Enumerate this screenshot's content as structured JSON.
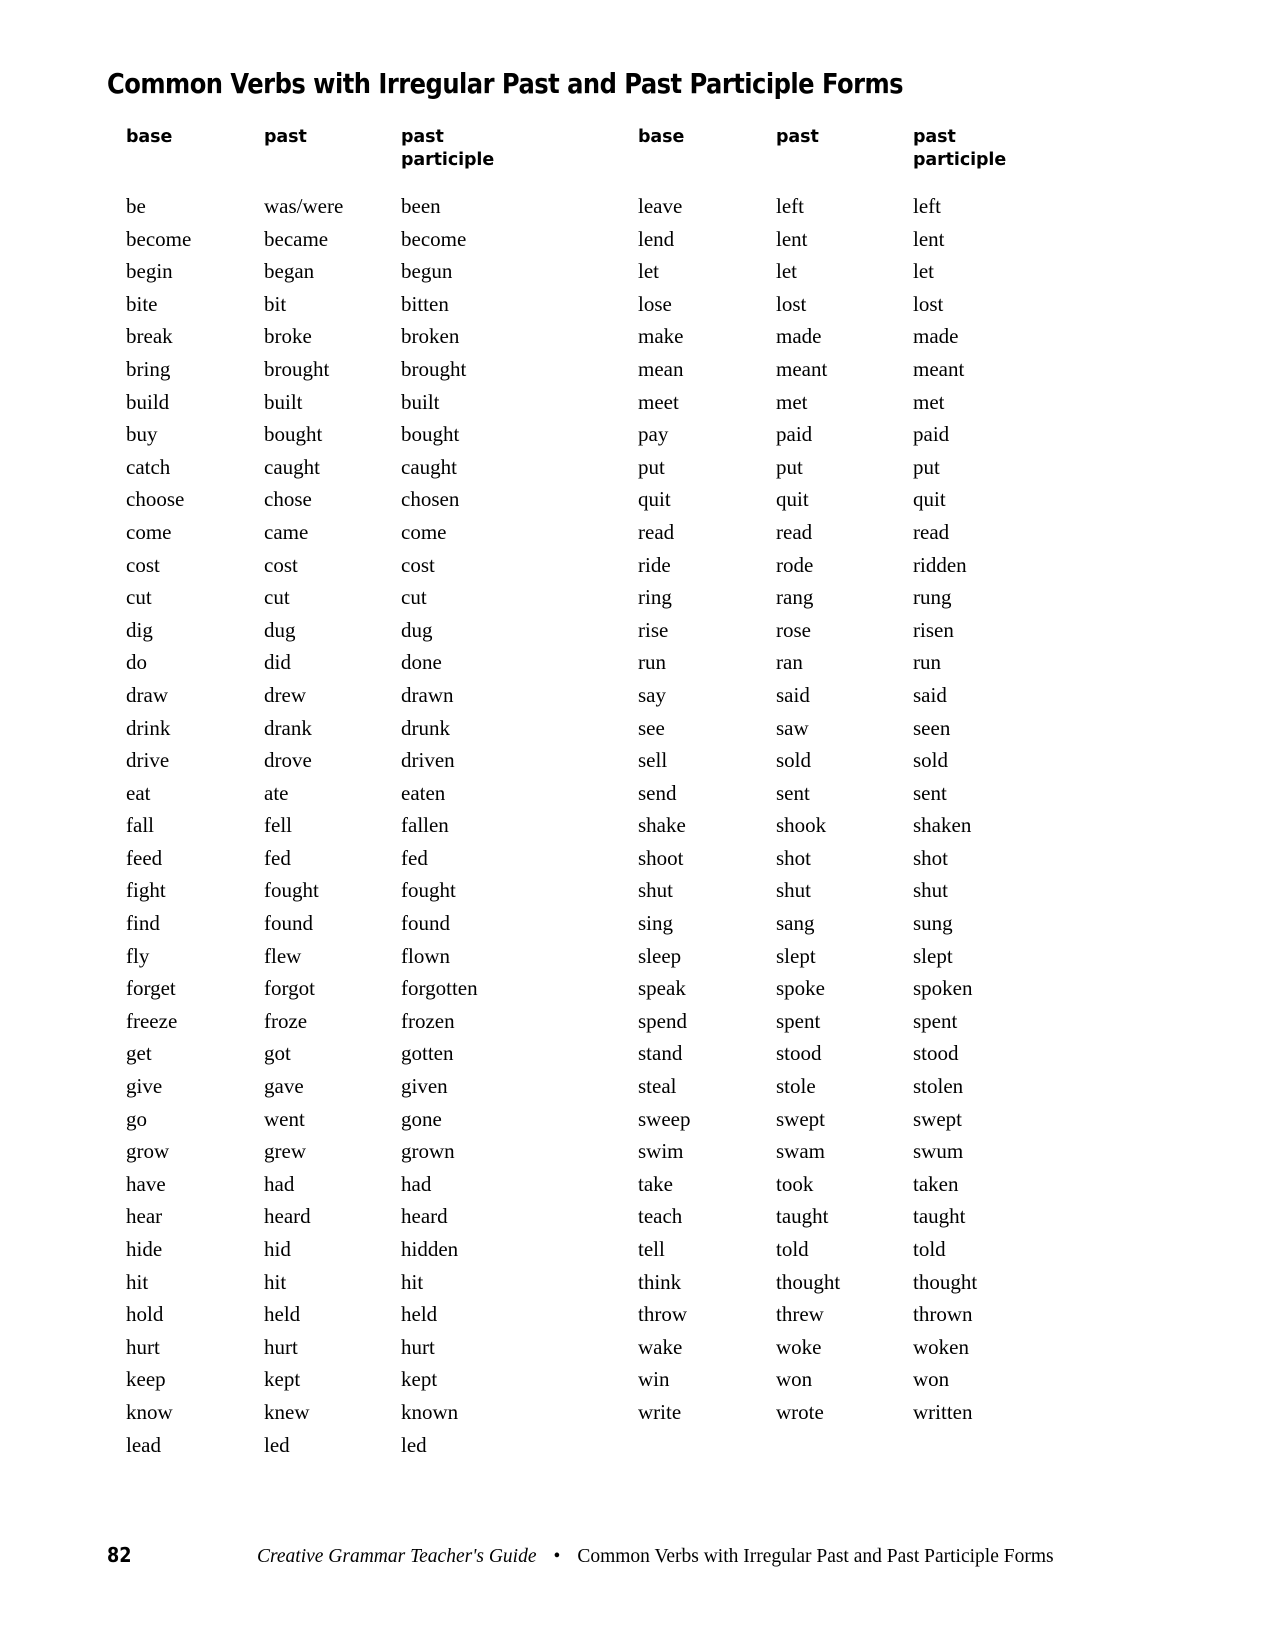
{
  "title": "Common Verbs with Irregular Past and Past Participle Forms",
  "columns": {
    "base": "base",
    "past": "past",
    "past_participle": "past\nparticiple"
  },
  "left_table": {
    "headers": [
      "base",
      "past",
      "past\nparticiple"
    ],
    "rows": [
      [
        "be",
        "was/were",
        "been"
      ],
      [
        "become",
        "became",
        "become"
      ],
      [
        "begin",
        "began",
        "begun"
      ],
      [
        "bite",
        "bit",
        "bitten"
      ],
      [
        "break",
        "broke",
        "broken"
      ],
      [
        "bring",
        "brought",
        "brought"
      ],
      [
        "build",
        "built",
        "built"
      ],
      [
        "buy",
        "bought",
        "bought"
      ],
      [
        "catch",
        "caught",
        "caught"
      ],
      [
        "choose",
        "chose",
        "chosen"
      ],
      [
        "come",
        "came",
        "come"
      ],
      [
        "cost",
        "cost",
        "cost"
      ],
      [
        "cut",
        "cut",
        "cut"
      ],
      [
        "dig",
        "dug",
        "dug"
      ],
      [
        "do",
        "did",
        "done"
      ],
      [
        "draw",
        "drew",
        "drawn"
      ],
      [
        "drink",
        "drank",
        "drunk"
      ],
      [
        "drive",
        "drove",
        "driven"
      ],
      [
        "eat",
        "ate",
        "eaten"
      ],
      [
        "fall",
        "fell",
        "fallen"
      ],
      [
        "feed",
        "fed",
        "fed"
      ],
      [
        "fight",
        "fought",
        "fought"
      ],
      [
        "find",
        "found",
        "found"
      ],
      [
        "fly",
        "flew",
        "flown"
      ],
      [
        "forget",
        "forgot",
        "forgotten"
      ],
      [
        "freeze",
        "froze",
        "frozen"
      ],
      [
        "get",
        "got",
        "gotten"
      ],
      [
        "give",
        "gave",
        "given"
      ],
      [
        "go",
        "went",
        "gone"
      ],
      [
        "grow",
        "grew",
        "grown"
      ],
      [
        "have",
        "had",
        "had"
      ],
      [
        "hear",
        "heard",
        "heard"
      ],
      [
        "hide",
        "hid",
        "hidden"
      ],
      [
        "hit",
        "hit",
        "hit"
      ],
      [
        "hold",
        "held",
        "held"
      ],
      [
        "hurt",
        "hurt",
        "hurt"
      ],
      [
        "keep",
        "kept",
        "kept"
      ],
      [
        "know",
        "knew",
        "known"
      ],
      [
        "lead",
        "led",
        "led"
      ]
    ]
  },
  "right_table": {
    "headers": [
      "base",
      "past",
      "past\nparticiple"
    ],
    "rows": [
      [
        "leave",
        "left",
        "left"
      ],
      [
        "lend",
        "lent",
        "lent"
      ],
      [
        "let",
        "let",
        "let"
      ],
      [
        "lose",
        "lost",
        "lost"
      ],
      [
        "make",
        "made",
        "made"
      ],
      [
        "mean",
        "meant",
        "meant"
      ],
      [
        "meet",
        "met",
        "met"
      ],
      [
        "pay",
        "paid",
        "paid"
      ],
      [
        "put",
        "put",
        "put"
      ],
      [
        "quit",
        "quit",
        "quit"
      ],
      [
        "read",
        "read",
        "read"
      ],
      [
        "ride",
        "rode",
        "ridden"
      ],
      [
        "ring",
        "rang",
        "rung"
      ],
      [
        "rise",
        "rose",
        "risen"
      ],
      [
        "run",
        "ran",
        "run"
      ],
      [
        "say",
        "said",
        "said"
      ],
      [
        "see",
        "saw",
        "seen"
      ],
      [
        "sell",
        "sold",
        "sold"
      ],
      [
        "send",
        "sent",
        "sent"
      ],
      [
        "shake",
        "shook",
        "shaken"
      ],
      [
        "shoot",
        "shot",
        "shot"
      ],
      [
        "shut",
        "shut",
        "shut"
      ],
      [
        "sing",
        "sang",
        "sung"
      ],
      [
        "sleep",
        "slept",
        "slept"
      ],
      [
        "speak",
        "spoke",
        "spoken"
      ],
      [
        "spend",
        "spent",
        "spent"
      ],
      [
        "stand",
        "stood",
        "stood"
      ],
      [
        "steal",
        "stole",
        "stolen"
      ],
      [
        "sweep",
        "swept",
        "swept"
      ],
      [
        "swim",
        "swam",
        "swum"
      ],
      [
        "take",
        "took",
        "taken"
      ],
      [
        "teach",
        "taught",
        "taught"
      ],
      [
        "tell",
        "told",
        "told"
      ],
      [
        "think",
        "thought",
        "thought"
      ],
      [
        "throw",
        "threw",
        "thrown"
      ],
      [
        "wake",
        "woke",
        "woken"
      ],
      [
        "win",
        "won",
        "won"
      ],
      [
        "write",
        "wrote",
        "written"
      ]
    ]
  },
  "footer": {
    "page_number": "82",
    "book_title": "Creative Grammar Teacher's Guide",
    "separator": "•",
    "section_title": "Common Verbs with Irregular Past and Past Participle Forms"
  }
}
